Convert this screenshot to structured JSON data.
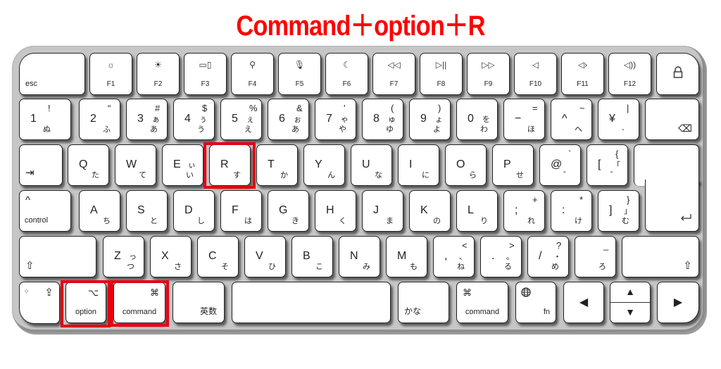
{
  "title": {
    "text": "Command＋option＋R",
    "color": "#ff0000"
  },
  "highlight_color": "#e60012",
  "function_row": {
    "esc": "esc",
    "keys": [
      {
        "label": "F1",
        "icon": "brightness-down-icon",
        "glyph": "☼"
      },
      {
        "label": "F2",
        "icon": "brightness-up-icon",
        "glyph": "☀"
      },
      {
        "label": "F3",
        "icon": "mission-control-icon",
        "glyph": "▭▯"
      },
      {
        "label": "F4",
        "icon": "search-icon",
        "glyph": "⚲"
      },
      {
        "label": "F5",
        "icon": "microphone-icon",
        "glyph": "🎙"
      },
      {
        "label": "F6",
        "icon": "moon-icon",
        "glyph": "☾"
      },
      {
        "label": "F7",
        "icon": "rewind-icon",
        "glyph": "◁◁"
      },
      {
        "label": "F8",
        "icon": "play-pause-icon",
        "glyph": "▷||"
      },
      {
        "label": "F9",
        "icon": "fast-forward-icon",
        "glyph": "▷▷"
      },
      {
        "label": "F10",
        "icon": "mute-icon",
        "glyph": "◁"
      },
      {
        "label": "F11",
        "icon": "volume-down-icon",
        "glyph": "◁›"
      },
      {
        "label": "F12",
        "icon": "volume-up-icon",
        "glyph": "◁))"
      }
    ],
    "lock_glyph": "🔒"
  },
  "number_row": [
    {
      "main": "1",
      "sym": "!",
      "kana1": "ぬ",
      "kana2": ""
    },
    {
      "main": "2",
      "sym": "“",
      "kana1": "ふ",
      "kana2": ""
    },
    {
      "main": "3",
      "sym": "#",
      "kana1": "あ",
      "kana2": "ぁ"
    },
    {
      "main": "4",
      "sym": "$",
      "kana1": "う",
      "kana2": "ぅ"
    },
    {
      "main": "5",
      "sym": "%",
      "kana1": "え",
      "kana2": "ぇ"
    },
    {
      "main": "6",
      "sym": "&",
      "kana1": "あ",
      "kana2": "ぉ"
    },
    {
      "main": "7",
      "sym": "'",
      "kana1": "や",
      "kana2": "ゃ"
    },
    {
      "main": "8",
      "sym": "(",
      "kana1": "ゆ",
      "kana2": "ゅ"
    },
    {
      "main": "9",
      "sym": ")",
      "kana1": "よ",
      "kana2": "ょ"
    },
    {
      "main": "0",
      "sym": "",
      "kana1": "わ",
      "kana2": "を"
    },
    {
      "main": "−",
      "sym": "=",
      "kana1": "ほ",
      "kana2": ""
    },
    {
      "main": "^",
      "sym": "~",
      "kana1": "へ",
      "kana2": ""
    },
    {
      "main": "¥",
      "sym": "|",
      "kana1": "-",
      "kana2": ""
    }
  ],
  "delete_glyph": "⌫",
  "top_row": [
    {
      "main": "Q",
      "sym": "",
      "kana1": "た",
      "kana2": ""
    },
    {
      "main": "W",
      "sym": "",
      "kana1": "て",
      "kana2": ""
    },
    {
      "main": "E",
      "sym": "",
      "kana1": "い",
      "kana2": "ぃ"
    },
    {
      "main": "R",
      "sym": "",
      "kana1": "す",
      "kana2": ""
    },
    {
      "main": "T",
      "sym": "",
      "kana1": "か",
      "kana2": ""
    },
    {
      "main": "Y",
      "sym": "",
      "kana1": "ん",
      "kana2": ""
    },
    {
      "main": "U",
      "sym": "",
      "kana1": "な",
      "kana2": ""
    },
    {
      "main": "I",
      "sym": "",
      "kana1": "に",
      "kana2": ""
    },
    {
      "main": "O",
      "sym": "",
      "kana1": "ら",
      "kana2": ""
    },
    {
      "main": "P",
      "sym": "",
      "kana1": "せ",
      "kana2": ""
    },
    {
      "main": "@",
      "sym": "`",
      "kana1": "゛",
      "kana2": ""
    },
    {
      "main": "[",
      "sym": "{",
      "kana1": "゜",
      "kana2": "「"
    }
  ],
  "tab_glyph": "⇥",
  "home_row": [
    {
      "main": "A",
      "sym": "",
      "kana1": "ち",
      "kana2": ""
    },
    {
      "main": "S",
      "sym": "",
      "kana1": "と",
      "kana2": ""
    },
    {
      "main": "D",
      "sym": "",
      "kana1": "し",
      "kana2": ""
    },
    {
      "main": "F",
      "sym": "",
      "kana1": "は",
      "kana2": ""
    },
    {
      "main": "G",
      "sym": "",
      "kana1": "き",
      "kana2": ""
    },
    {
      "main": "H",
      "sym": "",
      "kana1": "く",
      "kana2": ""
    },
    {
      "main": "J",
      "sym": "",
      "kana1": "ま",
      "kana2": ""
    },
    {
      "main": "K",
      "sym": "",
      "kana1": "の",
      "kana2": ""
    },
    {
      "main": "L",
      "sym": "",
      "kana1": "り",
      "kana2": ""
    },
    {
      "main": ";",
      "sym": "+",
      "kana1": "れ",
      "kana2": ""
    },
    {
      "main": ":",
      "sym": "*",
      "kana1": "け",
      "kana2": ""
    },
    {
      "main": "]",
      "sym": "}",
      "kana1": "む",
      "kana2": "」"
    }
  ],
  "control": {
    "glyph": "^",
    "label": "control"
  },
  "return_glyph": "⏎",
  "bottom_row": [
    {
      "main": "Z",
      "sym": "",
      "kana1": "つ",
      "kana2": "っ"
    },
    {
      "main": "X",
      "sym": "",
      "kana1": "さ",
      "kana2": ""
    },
    {
      "main": "C",
      "sym": "",
      "kana1": "そ",
      "kana2": ""
    },
    {
      "main": "V",
      "sym": "",
      "kana1": "ひ",
      "kana2": ""
    },
    {
      "main": "B",
      "sym": "",
      "kana1": "こ",
      "kana2": ""
    },
    {
      "main": "N",
      "sym": "",
      "kana1": "み",
      "kana2": ""
    },
    {
      "main": "M",
      "sym": "",
      "kana1": "も",
      "kana2": ""
    },
    {
      "main": ",",
      "sym": "<",
      "kana1": "ね",
      "kana2": "、"
    },
    {
      "main": ".",
      "sym": ">",
      "kana1": "る",
      "kana2": "。"
    },
    {
      "main": "/",
      "sym": "?",
      "kana1": "め",
      "kana2": "・"
    },
    {
      "main": "",
      "sym": "_",
      "kana1": "ろ",
      "kana2": ""
    }
  ],
  "shift_glyph": "⇧",
  "modifier_row": {
    "caps_dot": "○",
    "caps_glyph": "⇪",
    "option": {
      "glyph": "⌥",
      "label": "option"
    },
    "command_left": {
      "glyph": "⌘",
      "label": "command"
    },
    "eisu": "英数",
    "kana": "かな",
    "command_right": {
      "glyph": "⌘",
      "label": "command"
    },
    "fn": {
      "glyph": "🌐",
      "label": "fn"
    },
    "arrow_left": "◀",
    "arrow_up": "▲",
    "arrow_down": "▼",
    "arrow_right": "▶"
  }
}
